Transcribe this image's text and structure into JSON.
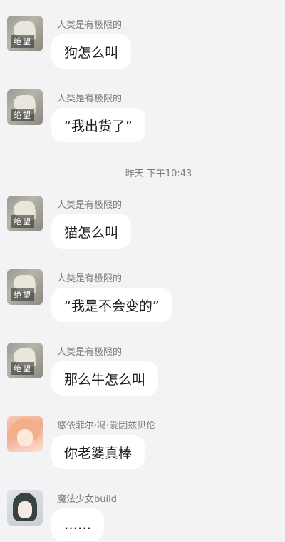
{
  "timestamp": "昨天 下午10:43",
  "messages": [
    {
      "sender": "人类是有极限的",
      "avatar_label": "绝望",
      "text": "狗怎么叫"
    },
    {
      "sender": "人类是有极限的",
      "avatar_label": "绝望",
      "text": "“我出货了”"
    },
    {
      "sender": "人类是有极限的",
      "avatar_label": "绝望",
      "text": "猫怎么叫"
    },
    {
      "sender": "人类是有极限的",
      "avatar_label": "绝望",
      "text": "“我是不会变的”"
    },
    {
      "sender": "人类是有极限的",
      "avatar_label": "绝望",
      "text": "那么牛怎么叫"
    },
    {
      "sender": "悠依菲尔·冯·爱因兹贝伦",
      "text": "你老婆真棒"
    },
    {
      "sender": "魔法少女build",
      "text": "……"
    }
  ]
}
